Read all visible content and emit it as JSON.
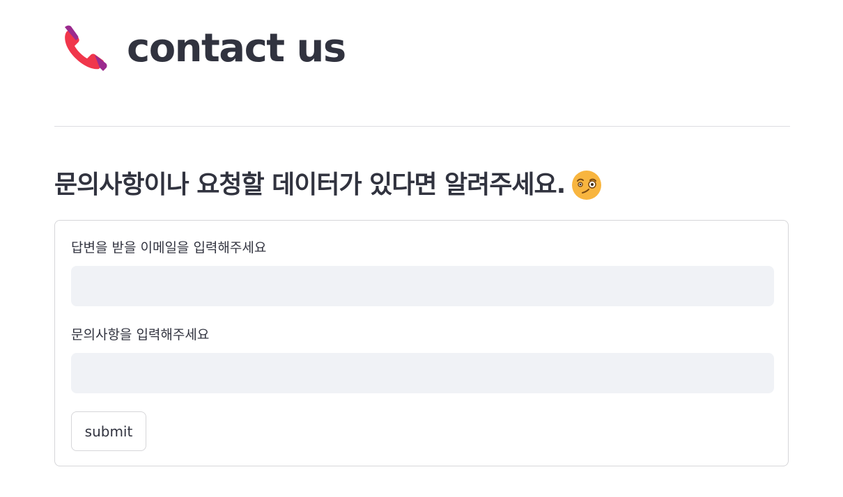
{
  "header": {
    "title": "contact us",
    "icon": "telephone-receiver-icon"
  },
  "intro": {
    "text": "문의사항이나 요청할 데이터가 있다면 알려주세요.",
    "icon": "winking-face-icon"
  },
  "form": {
    "email_label": "답변을 받을 이메일을 입력해주세요",
    "email_value": "",
    "inquiry_label": "문의사항을 입력해주세요",
    "inquiry_value": "",
    "submit_label": "submit"
  },
  "colors": {
    "text": "#31333f",
    "input_bg": "#f0f2f6",
    "border": "#d6d6d9",
    "divider": "#dcdde1"
  }
}
